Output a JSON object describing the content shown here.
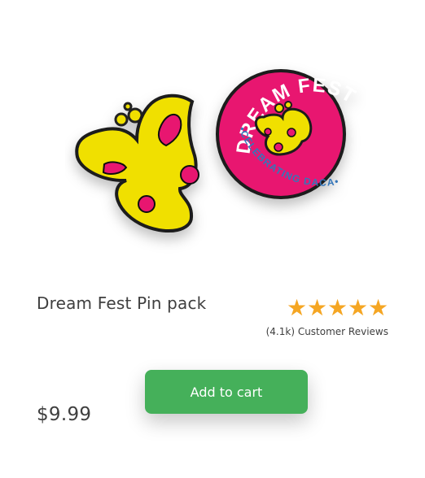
{
  "product": {
    "title": "Dream Fest Pin pack",
    "price": "$9.99",
    "image_alt": "Dream Fest butterfly pins",
    "pin_text": "DREAM FEST",
    "pin_subtext": "•CELEBRATING DACA•"
  },
  "rating": {
    "value": 5,
    "max": 5,
    "stars": [
      "★",
      "★",
      "★",
      "★",
      "★"
    ],
    "review_count_text": "(4.1k) Customer Reviews"
  },
  "actions": {
    "add_to_cart_label": "Add to cart"
  },
  "colors": {
    "accent_green": "#45b05a",
    "star_orange": "#f5a623",
    "pin_yellow": "#f0e000",
    "pin_pink": "#e8176f",
    "text_dark": "#3f3f3f"
  },
  "icons": {
    "product": "butterfly-pin-icon",
    "rating": "star-icon"
  }
}
